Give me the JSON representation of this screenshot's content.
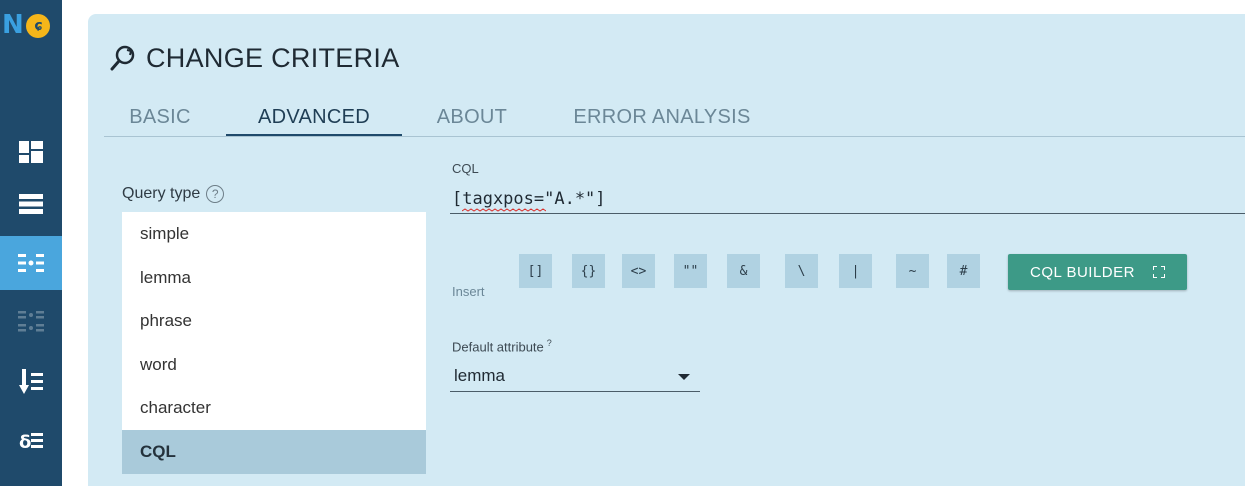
{
  "brand": {
    "logo_text": "N",
    "logo_dot": "ɕ"
  },
  "sidebar": {
    "items": [
      {
        "icon": "dashboard-icon"
      },
      {
        "icon": "list-icon"
      },
      {
        "icon": "concordance-icon",
        "active": true
      },
      {
        "icon": "parallel-concordance-icon"
      },
      {
        "icon": "sort-down-icon"
      },
      {
        "icon": "sort-numeric-icon"
      }
    ]
  },
  "header": {
    "title": "CHANGE CRITERIA",
    "title_icon": "search-refresh-icon"
  },
  "tabs": [
    {
      "label": "BASIC"
    },
    {
      "label": "ADVANCED",
      "active": true
    },
    {
      "label": "ABOUT"
    },
    {
      "label": "ERROR ANALYSIS"
    }
  ],
  "query_type": {
    "label": "Query type",
    "help": "?",
    "options": [
      "simple",
      "lemma",
      "phrase",
      "word",
      "character",
      "CQL"
    ],
    "selected": "CQL"
  },
  "cql": {
    "label": "CQL",
    "value": "[tagxpos=\"A.*\"]"
  },
  "insert": {
    "label": "Insert",
    "buttons": [
      "[]",
      "{}",
      "<>",
      "\"\"",
      "&",
      "\\",
      "|",
      "~",
      "#"
    ],
    "builder_label": "CQL BUILDER",
    "builder_icon": "fullscreen-icon"
  },
  "default_attribute": {
    "label": "Default attribute",
    "help": "?",
    "value": "lemma"
  },
  "colors": {
    "sidebar_bg": "#1f4a6b",
    "panel_bg": "#d3eaf4",
    "accent": "#3d9a87",
    "active_side": "#4aa6dd"
  }
}
